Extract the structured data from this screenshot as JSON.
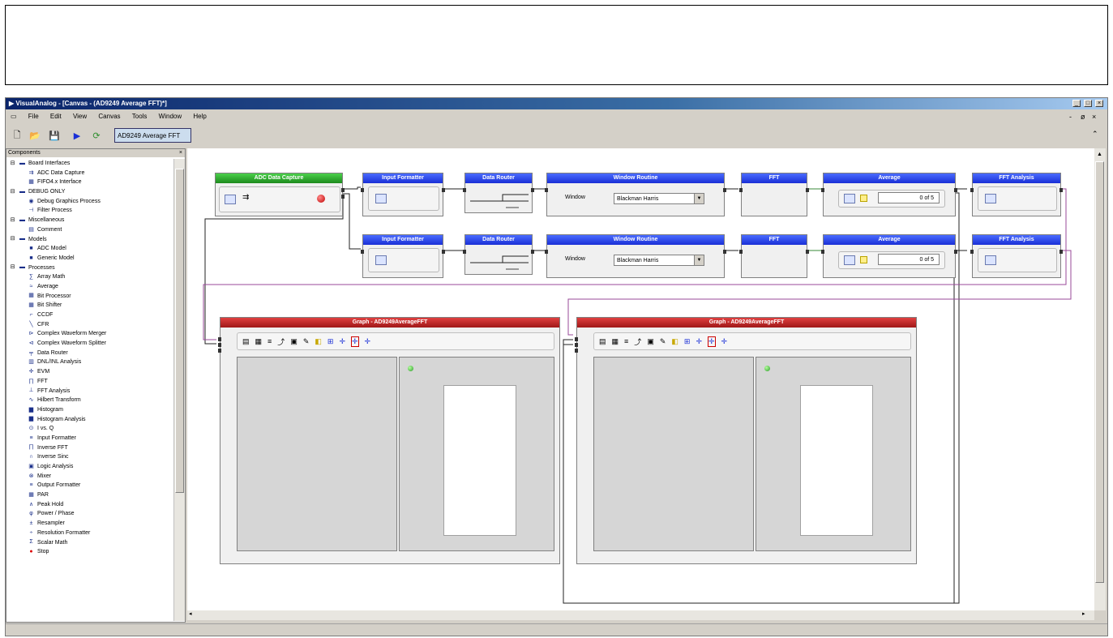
{
  "window": {
    "title": "VisualAnalog - [Canvas - (AD9249 Average FFT)*]",
    "controls": [
      "_",
      "□",
      "×"
    ],
    "mdi_controls": [
      "-",
      "ø",
      "×"
    ]
  },
  "menu": [
    "File",
    "Edit",
    "View",
    "Canvas",
    "Tools",
    "Window",
    "Help"
  ],
  "toolbar": {
    "canvas_name": "AD9249 Average FFT",
    "buttons": [
      "new-icon",
      "open-icon",
      "save-icon",
      "run-icon",
      "refresh-icon"
    ]
  },
  "sidebar": {
    "header": "Components",
    "items": [
      {
        "label": "Board Interfaces",
        "level": 0,
        "icon": "folder-icon"
      },
      {
        "label": "ADC Data Capture",
        "level": 1,
        "icon": "capture-icon"
      },
      {
        "label": "FIFO4.x Interface",
        "level": 1,
        "icon": "board-icon"
      },
      {
        "label": "DEBUG ONLY",
        "level": 0,
        "icon": "folder-icon"
      },
      {
        "label": "Debug Graphics Process",
        "level": 1,
        "icon": "globe-icon"
      },
      {
        "label": "Filter Process",
        "level": 1,
        "icon": "filter-icon"
      },
      {
        "label": "Miscellaneous",
        "level": 0,
        "icon": "folder-icon"
      },
      {
        "label": "Comment",
        "level": 1,
        "icon": "comment-icon"
      },
      {
        "label": "Models",
        "level": 0,
        "icon": "folder-icon"
      },
      {
        "label": "ADC Model",
        "level": 1,
        "icon": "model-icon"
      },
      {
        "label": "Generic Model",
        "level": 1,
        "icon": "model-icon"
      },
      {
        "label": "Processes",
        "level": 0,
        "icon": "folder-icon"
      },
      {
        "label": "Array Math",
        "level": 1,
        "icon": "math-icon"
      },
      {
        "label": "Average",
        "level": 1,
        "icon": "average-icon"
      },
      {
        "label": "Bit Processor",
        "level": 1,
        "icon": "bit-icon"
      },
      {
        "label": "Bit Shifter",
        "level": 1,
        "icon": "bit-icon"
      },
      {
        "label": "CCDF",
        "level": 1,
        "icon": "ccdf-icon"
      },
      {
        "label": "CFR",
        "level": 1,
        "icon": "cfr-icon"
      },
      {
        "label": "Complex Waveform Merger",
        "level": 1,
        "icon": "merge-icon"
      },
      {
        "label": "Complex Waveform Splitter",
        "level": 1,
        "icon": "split-icon"
      },
      {
        "label": "Data Router",
        "level": 1,
        "icon": "router-icon"
      },
      {
        "label": "DNL/INL Analysis",
        "level": 1,
        "icon": "chart-icon"
      },
      {
        "label": "EVM",
        "level": 1,
        "icon": "evm-icon"
      },
      {
        "label": "FFT",
        "level": 1,
        "icon": "fft-icon"
      },
      {
        "label": "FFT Analysis",
        "level": 1,
        "icon": "fft-analysis-icon"
      },
      {
        "label": "Hilbert Transform",
        "level": 1,
        "icon": "hilbert-icon"
      },
      {
        "label": "Histogram",
        "level": 1,
        "icon": "histogram-icon"
      },
      {
        "label": "Histogram Analysis",
        "level": 1,
        "icon": "histogram-icon"
      },
      {
        "label": "I vs. Q",
        "level": 1,
        "icon": "iq-icon"
      },
      {
        "label": "Input Formatter",
        "level": 1,
        "icon": "formatter-icon"
      },
      {
        "label": "Inverse FFT",
        "level": 1,
        "icon": "fft-icon"
      },
      {
        "label": "Inverse Sinc",
        "level": 1,
        "icon": "sinc-icon"
      },
      {
        "label": "Logic Analysis",
        "level": 1,
        "icon": "logic-icon"
      },
      {
        "label": "Mixer",
        "level": 1,
        "icon": "mixer-icon"
      },
      {
        "label": "Output Formatter",
        "level": 1,
        "icon": "formatter-icon"
      },
      {
        "label": "PAR",
        "level": 1,
        "icon": "par-icon"
      },
      {
        "label": "Peak Hold",
        "level": 1,
        "icon": "peak-icon"
      },
      {
        "label": "Power / Phase",
        "level": 1,
        "icon": "power-icon"
      },
      {
        "label": "Resampler",
        "level": 1,
        "icon": "resample-icon"
      },
      {
        "label": "Resolution Formatter",
        "level": 1,
        "icon": "resolution-icon"
      },
      {
        "label": "Scalar Math",
        "level": 1,
        "icon": "scalar-icon"
      },
      {
        "label": "Stop",
        "level": 1,
        "icon": "stop-icon"
      }
    ]
  },
  "canvas": {
    "capture": {
      "title": "ADC Data Capture"
    },
    "row1": {
      "input_formatter": "Input Formatter",
      "data_router": "Data Router",
      "window_routine": "Window Routine",
      "window_label": "Window",
      "window_value": "Blackman Harris",
      "fft": "FFT",
      "average": "Average",
      "average_count": "0 of 5",
      "fft_analysis": "FFT Analysis"
    },
    "row2": {
      "input_formatter": "Input Formatter",
      "data_router": "Data Router",
      "window_routine": "Window Routine",
      "window_label": "Window",
      "window_value": "Blackman Harris",
      "fft": "FFT",
      "average": "Average",
      "average_count": "0 of 5",
      "fft_analysis": "FFT Analysis"
    },
    "graph1": {
      "title": "Graph - AD9249AverageFFT"
    },
    "graph2": {
      "title": "Graph - AD9249AverageFFT"
    }
  },
  "colors": {
    "block_title": "#1a2fd6",
    "capture_title": "#1d8a1d",
    "graph_title": "#a01818",
    "wire_dark": "#222222",
    "wire_purple": "#9a4a9a",
    "wire_green": "#2f8f2f"
  }
}
